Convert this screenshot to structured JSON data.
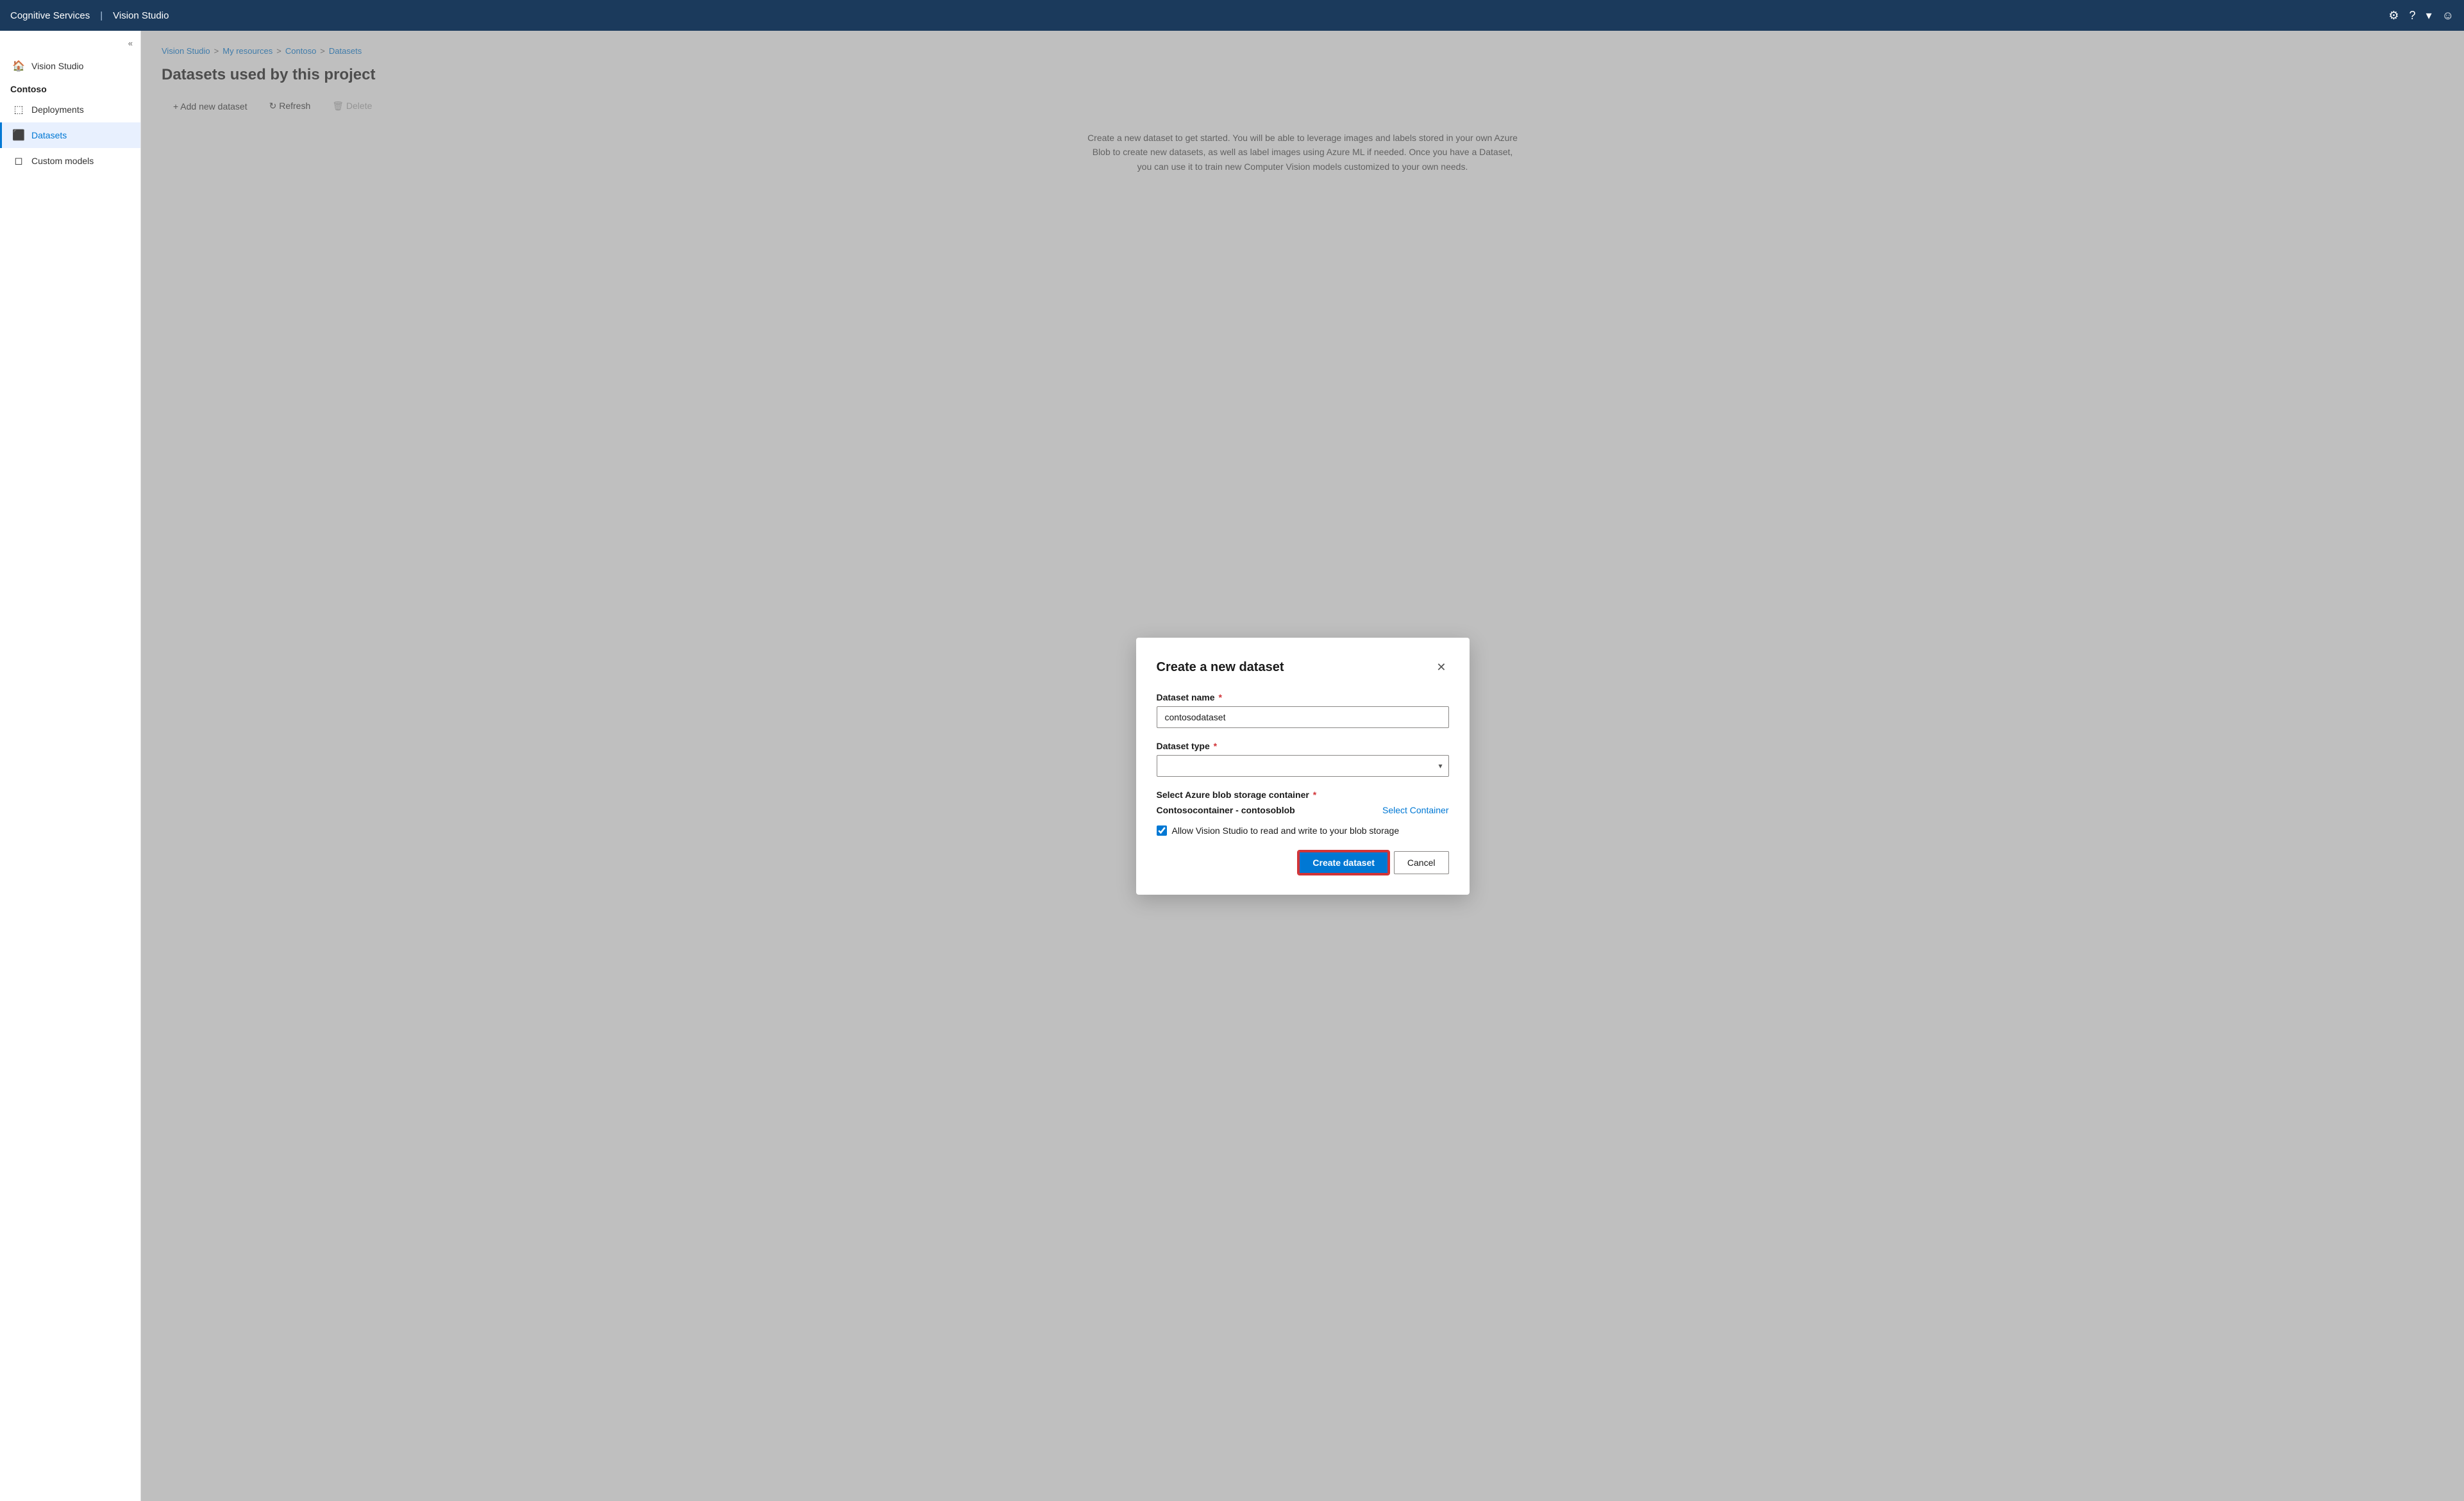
{
  "topbar": {
    "app_name": "Cognitive Services",
    "divider": "|",
    "studio_name": "Vision Studio",
    "icons": {
      "settings": "⚙",
      "help": "?",
      "chevron_down": "▾",
      "user": "☺"
    }
  },
  "sidebar": {
    "collapse_label": "«",
    "project_label": "Contoso",
    "items": [
      {
        "id": "vision-studio",
        "label": "Vision Studio",
        "icon": "🏠",
        "active": false
      },
      {
        "id": "deployments",
        "label": "Deployments",
        "icon": "⬚",
        "active": false
      },
      {
        "id": "datasets",
        "label": "Datasets",
        "icon": "⬛",
        "active": true
      },
      {
        "id": "custom-models",
        "label": "Custom models",
        "icon": "◻",
        "active": false
      }
    ]
  },
  "breadcrumb": {
    "items": [
      {
        "label": "Vision Studio",
        "link": true
      },
      {
        "label": ">",
        "link": false
      },
      {
        "label": "My resources",
        "link": true
      },
      {
        "label": ">",
        "link": false
      },
      {
        "label": "Contoso",
        "link": true
      },
      {
        "label": ">",
        "link": false
      },
      {
        "label": "Datasets",
        "link": true
      }
    ]
  },
  "page": {
    "title": "Datasets used by this project",
    "toolbar": {
      "add_label": "+ Add new dataset",
      "refresh_label": "↻  Refresh",
      "delete_label": "🗑  Delete"
    },
    "description": "Create a new dataset to get started. You will be able to leverage images and labels stored in your own Azure Blob to create new datasets, as well as label images using Azure ML if needed. Once you have a Dataset, you can use it to train new Computer Vision models customized to your own needs."
  },
  "modal": {
    "title": "Create a new dataset",
    "close_label": "✕",
    "fields": {
      "dataset_name": {
        "label": "Dataset name",
        "required": true,
        "value": "contosodataset",
        "placeholder": ""
      },
      "dataset_type": {
        "label": "Dataset type",
        "required": true,
        "value": "",
        "placeholder": "",
        "options": []
      },
      "blob_container": {
        "label": "Select Azure blob storage container",
        "required": true,
        "container_name": "Contosocontainer - contosoblob",
        "select_link": "Select Container"
      },
      "checkbox": {
        "label": "Allow Vision Studio to read and write to your blob storage",
        "checked": true
      }
    },
    "buttons": {
      "create": "Create dataset",
      "cancel": "Cancel"
    }
  }
}
